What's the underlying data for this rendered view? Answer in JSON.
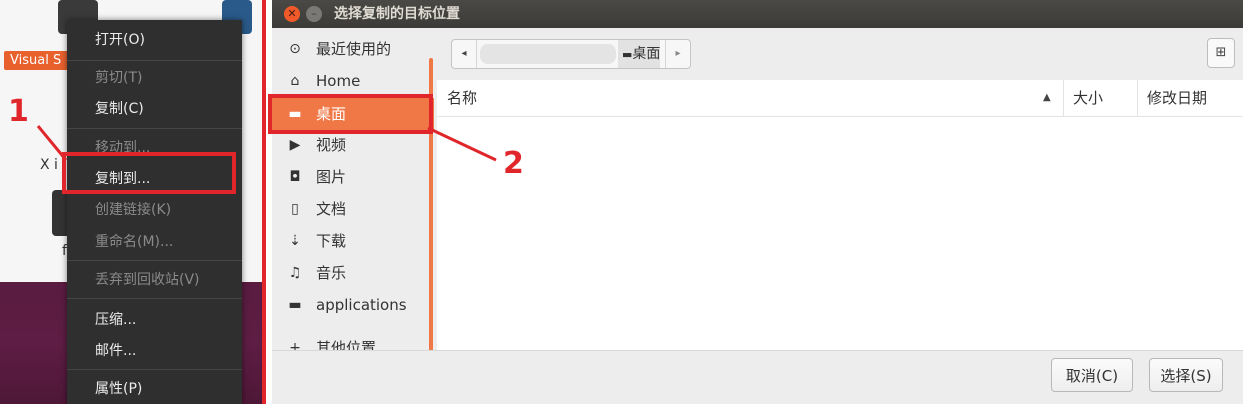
{
  "annotations": {
    "step1": "1",
    "step2": "2"
  },
  "desktop": {
    "app_label": "Visual S",
    "x_label": "X i",
    "fragment": "f"
  },
  "context_menu": {
    "items": [
      {
        "label": "打开(O)",
        "enabled": true
      },
      {
        "label": "剪切(T)",
        "enabled": false
      },
      {
        "label": "复制(C)",
        "enabled": true
      },
      {
        "label": "移动到...",
        "enabled": false
      },
      {
        "label": "复制到...",
        "enabled": true
      },
      {
        "label": "创建链接(K)",
        "enabled": false
      },
      {
        "label": "重命名(M)...",
        "enabled": false
      },
      {
        "label": "丢弃到回收站(V)",
        "enabled": false
      },
      {
        "label": "压缩...",
        "enabled": true
      },
      {
        "label": "邮件...",
        "enabled": true
      },
      {
        "label": "属性(P)",
        "enabled": true
      }
    ]
  },
  "dialog": {
    "title": "选择复制的目标位置",
    "close_glyph": "✕",
    "min_glyph": "–",
    "sidebar": [
      {
        "label": "最近使用的",
        "icon": "clock-icon",
        "glyph": "⊙"
      },
      {
        "label": "Home",
        "icon": "home-icon",
        "glyph": "⌂"
      },
      {
        "label": "桌面",
        "icon": "folder-icon",
        "glyph": "▬",
        "selected": true
      },
      {
        "label": "视频",
        "icon": "video-icon",
        "glyph": "▶"
      },
      {
        "label": "图片",
        "icon": "camera-icon",
        "glyph": "◘"
      },
      {
        "label": "文档",
        "icon": "document-icon",
        "glyph": "▯"
      },
      {
        "label": "下载",
        "icon": "download-icon",
        "glyph": "⇣"
      },
      {
        "label": "音乐",
        "icon": "music-icon",
        "glyph": "♫"
      },
      {
        "label": "applications",
        "icon": "folder-icon",
        "glyph": "▬"
      },
      {
        "label": "其他位置",
        "icon": "plus-icon",
        "glyph": "+"
      }
    ],
    "path": {
      "current": "桌面",
      "left_glyph": "◂",
      "right_glyph": "▸"
    },
    "new_folder_glyph": "⊞",
    "columns": {
      "name": "名称",
      "size": "大小",
      "modified": "修改日期",
      "sort_glyph": "▲"
    },
    "buttons": {
      "cancel": "取消(C)",
      "select": "选择(S)"
    }
  }
}
